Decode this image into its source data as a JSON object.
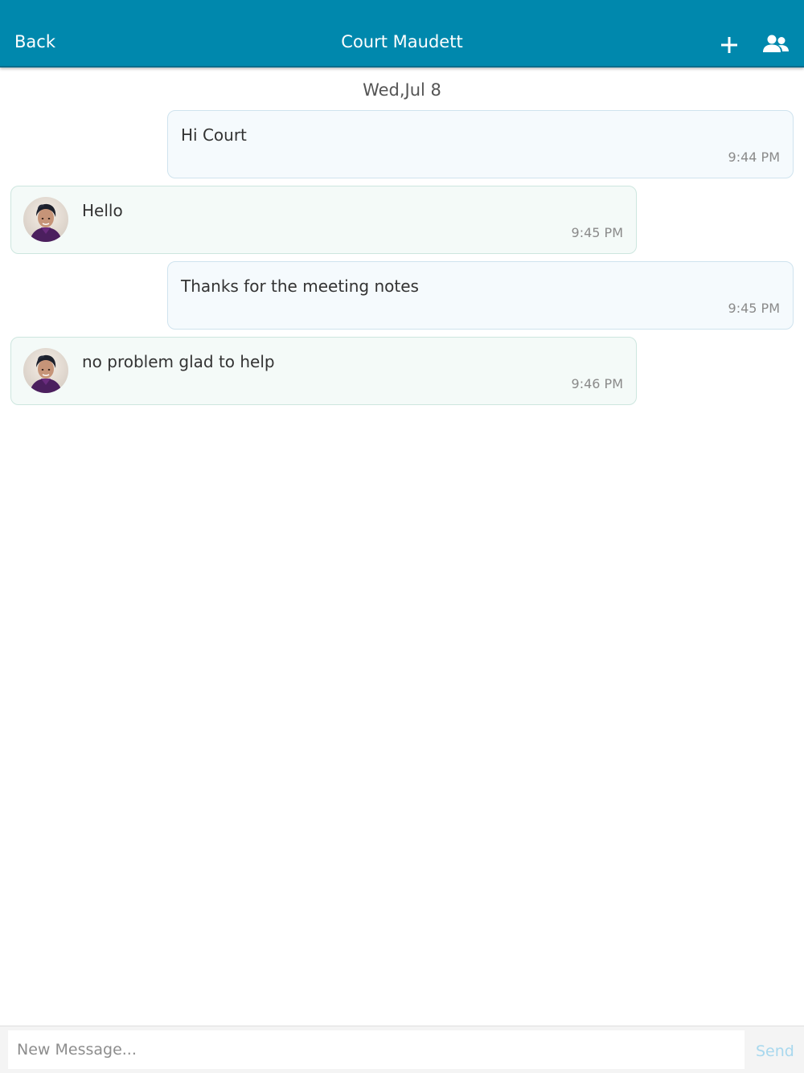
{
  "header": {
    "back_label": "Back",
    "title": "Court Maudett",
    "add_icon": "plus-icon",
    "participants_icon": "people-icon",
    "background_color": "#0088ad"
  },
  "conversation": {
    "date_label": "Wed,Jul 8",
    "messages": [
      {
        "direction": "sent",
        "text": "Hi Court",
        "time": "9:44 PM"
      },
      {
        "direction": "received",
        "text": "Hello",
        "time": "9:45 PM"
      },
      {
        "direction": "sent",
        "text": "Thanks for the meeting notes",
        "time": "9:45 PM"
      },
      {
        "direction": "received",
        "text": "no problem glad to help",
        "time": "9:46 PM"
      }
    ]
  },
  "composer": {
    "placeholder": "New Message...",
    "value": "",
    "send_label": "Send",
    "send_color": "#a8d8ee"
  }
}
